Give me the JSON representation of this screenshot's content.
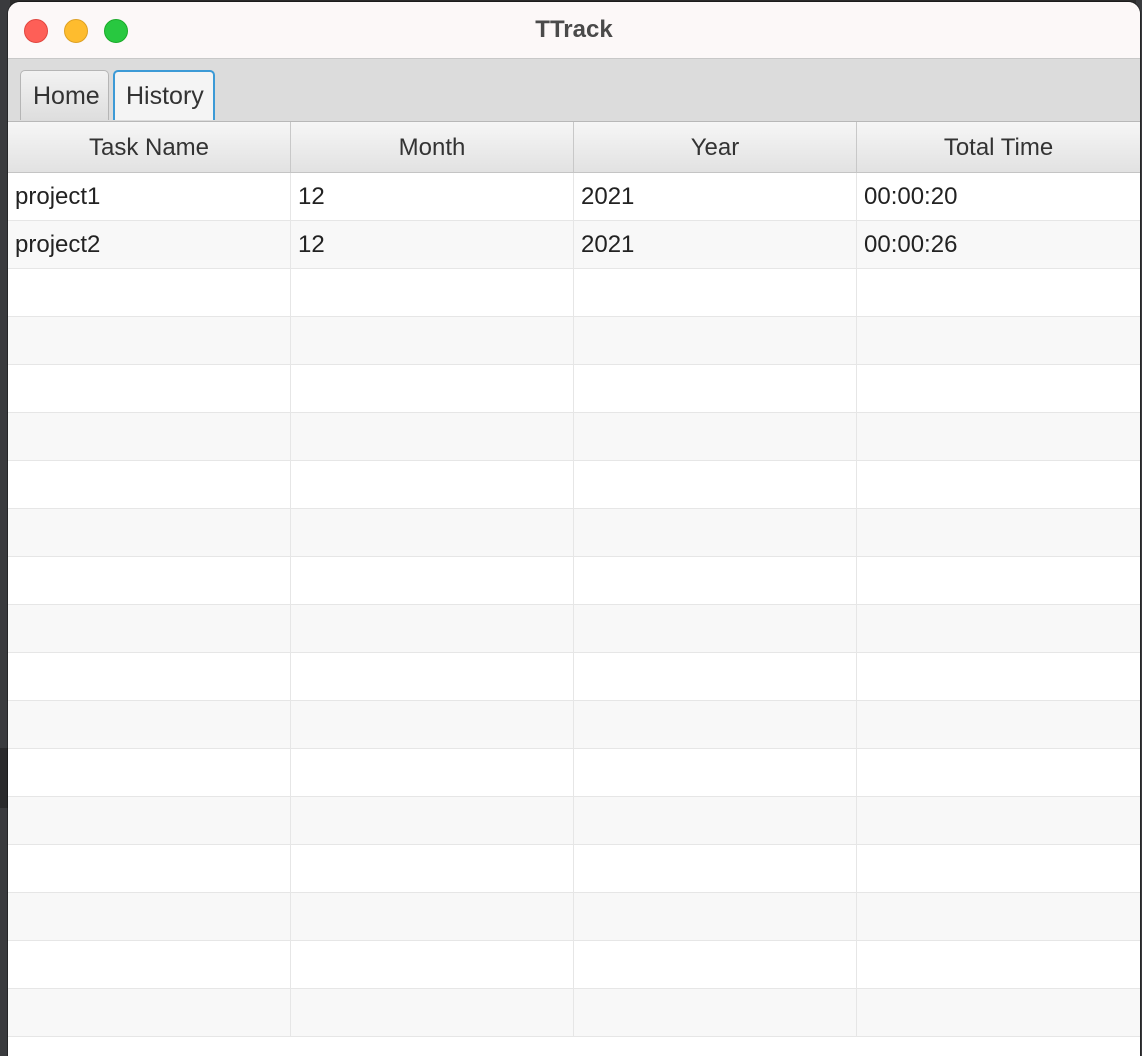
{
  "window": {
    "title": "TTrack"
  },
  "tabs": [
    {
      "label": "Home",
      "selected": false
    },
    {
      "label": "History",
      "selected": true
    }
  ],
  "table": {
    "columns": [
      "Task Name",
      "Month",
      "Year",
      "Total Time"
    ],
    "rows": [
      [
        "project1",
        "12",
        "2021",
        "00:00:20"
      ],
      [
        "project2",
        "12",
        "2021",
        "00:00:26"
      ]
    ],
    "empty_rows": 16
  },
  "colors": {
    "close": "#fe5f57",
    "minimize": "#febc2e",
    "zoom": "#28c840",
    "tab_focus": "#3c9ad6"
  }
}
